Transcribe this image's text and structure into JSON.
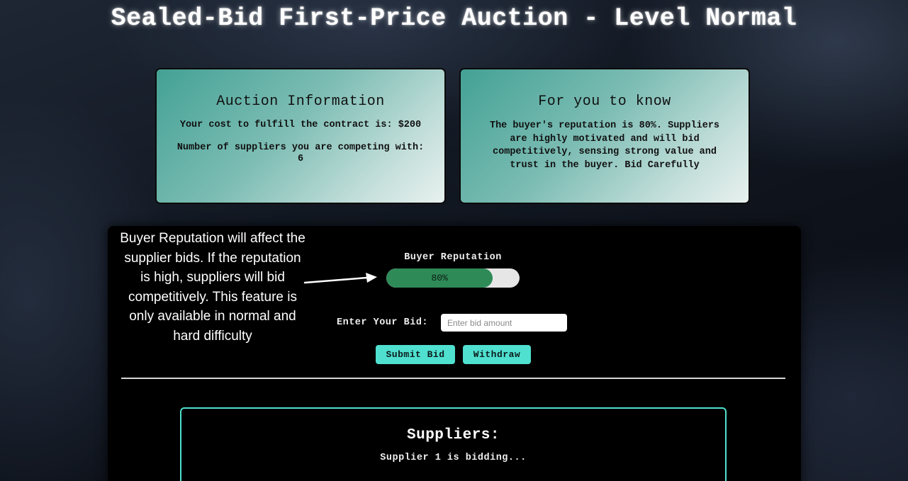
{
  "page": {
    "title": "Sealed-Bid First-Price Auction - Level Normal"
  },
  "auction_info": {
    "title": "Auction Information",
    "cost_text": "Your cost to fulfill the contract is: $200",
    "competitors_text": "Number of suppliers you are competing with: 6"
  },
  "for_you_to_know": {
    "title": "For you to know",
    "text": "The buyer's reputation is 80%. Suppliers are highly motivated and will bid competitively, sensing strong value and trust in the buyer. Bid Carefully"
  },
  "annotation": {
    "text": "Buyer Reputation will affect the supplier bids. If the reputation is high, suppliers will bid competitively. This feature is only available in normal and hard difficulty"
  },
  "reputation": {
    "label": "Buyer Reputation",
    "value_text": "80%",
    "value": 0.8,
    "fill_color": "#2e8a57",
    "track_color": "#e6e6e6"
  },
  "bid": {
    "label": "Enter Your Bid:",
    "placeholder": "Enter bid amount",
    "value": ""
  },
  "actions": {
    "submit_label": "Submit Bid",
    "withdraw_label": "Withdraw",
    "button_color": "#4fe0d0"
  },
  "suppliers": {
    "title": "Suppliers:",
    "status": "Supplier 1 is bidding...",
    "border_color": "#4fe0d0"
  },
  "icons": {
    "annotation_arrow": "arrow-right-icon"
  }
}
